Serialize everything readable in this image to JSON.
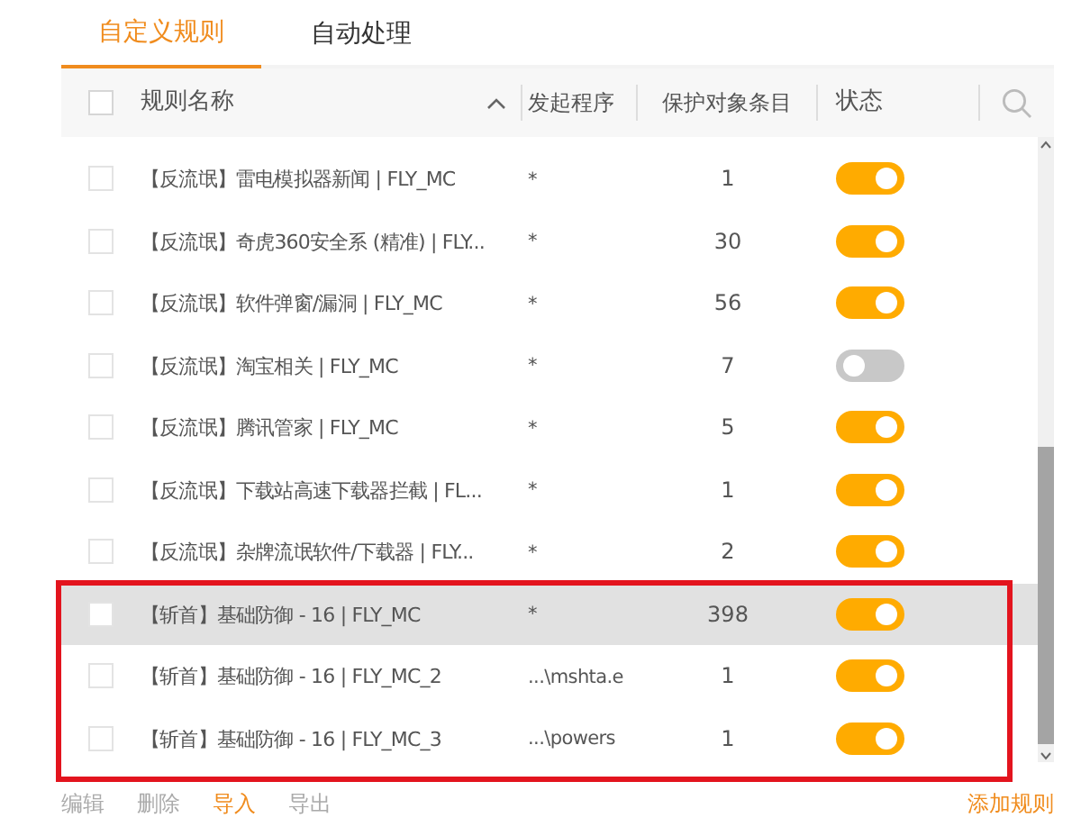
{
  "tabs": [
    {
      "label": "自定义规则",
      "selected": true
    },
    {
      "label": "自动处理",
      "selected": false
    }
  ],
  "table": {
    "select_all": {
      "checked": false
    },
    "columns": [
      "规则名称",
      "发起程序",
      "保护对象条目",
      "状态"
    ],
    "rows": [
      {
        "name": "【反流氓】雷电模拟器新闻 | FLY_MC",
        "program": "*",
        "count": "1",
        "enabled": true,
        "checked": false,
        "selected": false
      },
      {
        "name": "【反流氓】奇虎360安全系 (精准) | FLY...",
        "program": "*",
        "count": "30",
        "enabled": true,
        "checked": false,
        "selected": false
      },
      {
        "name": "【反流氓】软件弹窗/漏洞 | FLY_MC",
        "program": "*",
        "count": "56",
        "enabled": true,
        "checked": false,
        "selected": false
      },
      {
        "name": "【反流氓】淘宝相关 | FLY_MC",
        "program": "*",
        "count": "7",
        "enabled": false,
        "checked": false,
        "selected": false
      },
      {
        "name": "【反流氓】腾讯管家 | FLY_MC",
        "program": "*",
        "count": "5",
        "enabled": true,
        "checked": false,
        "selected": false
      },
      {
        "name": "【反流氓】下载站高速下载器拦截 | FL...",
        "program": "*",
        "count": "1",
        "enabled": true,
        "checked": false,
        "selected": false
      },
      {
        "name": "【反流氓】杂牌流氓软件/下载器 | FLY...",
        "program": "*",
        "count": "2",
        "enabled": true,
        "checked": false,
        "selected": false
      },
      {
        "name": "【斩首】基础防御 - 16 | FLY_MC",
        "program": "*",
        "count": "398",
        "enabled": true,
        "checked": false,
        "selected": true
      },
      {
        "name": "【斩首】基础防御 - 16 | FLY_MC_2",
        "program": "...\\mshta.e",
        "count": "1",
        "enabled": true,
        "checked": false,
        "selected": false
      },
      {
        "name": "【斩首】基础防御 - 16 | FLY_MC_3",
        "program": "...\\powers",
        "count": "1",
        "enabled": true,
        "checked": false,
        "selected": false
      }
    ]
  },
  "footer": {
    "actions": [
      {
        "label": "编辑",
        "disabled": true
      },
      {
        "label": "删除",
        "disabled": true
      },
      {
        "label": "导入",
        "disabled": false
      },
      {
        "label": "导出",
        "disabled": true
      }
    ],
    "add_button": "添加规则"
  }
}
